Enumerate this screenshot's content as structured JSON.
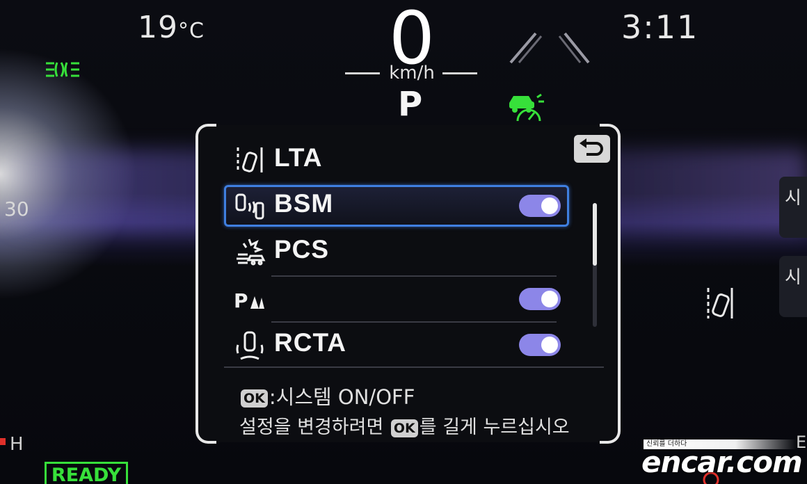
{
  "status_bar": {
    "temperature_value": "19",
    "temperature_unit": "°C",
    "clock": "3:11",
    "speed": "0",
    "speed_unit": "km/h",
    "gear": "P"
  },
  "gauges": {
    "odometer_fragment": "30",
    "fuel_h_label": "H",
    "right_edge_label": "E",
    "ready_indicator": "READY"
  },
  "menu": {
    "items": [
      {
        "name": "LTA",
        "label": "LTA",
        "icon": "lane-trace-icon",
        "has_toggle": false,
        "selected": false
      },
      {
        "name": "BSM",
        "label": "BSM",
        "icon": "blind-spot-monitor-icon",
        "has_toggle": true,
        "toggle_on": true,
        "selected": true
      },
      {
        "name": "PCS",
        "label": "PCS",
        "icon": "pre-collision-icon",
        "has_toggle": false,
        "selected": false
      },
      {
        "name": "parking-sensor",
        "label": "",
        "icon": "parking-sensor-icon",
        "has_toggle": true,
        "toggle_on": true,
        "selected": false
      },
      {
        "name": "RCTA",
        "label": "RCTA",
        "icon": "rear-cross-traffic-icon",
        "has_toggle": true,
        "toggle_on": true,
        "selected": false
      }
    ],
    "hint_ok_badge": "OK",
    "hint_line1_text": ":시스템 ON/OFF",
    "hint_line2_prefix": "설정을 변경하려면 ",
    "hint_line2_suffix": "를 길게 누르십시오"
  },
  "side_buttons": {
    "button1": "시",
    "button2": "시"
  },
  "watermark": {
    "tagline": "신뢰를 더하다",
    "brand": "encar.com"
  },
  "colors": {
    "accent_green": "#37e03a",
    "toggle_on": "#8c86e8",
    "selection_border": "#3f7fe0",
    "warning_red": "#e0302a"
  }
}
